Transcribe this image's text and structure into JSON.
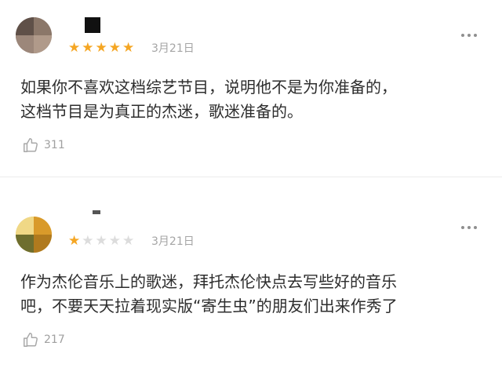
{
  "reviews": [
    {
      "rating": 5,
      "max_rating": 5,
      "date": "3月21日",
      "content_lines": [
        "如果你不喜欢这档综艺节目，说明他不是为你准备的，",
        "这档节目是为真正的杰迷，歌迷准备的。"
      ],
      "likes": "311"
    },
    {
      "rating": 1,
      "max_rating": 5,
      "date": "3月21日",
      "content_lines": [
        "作为杰伦音乐上的歌迷，拜托杰伦快点去写些好的音乐",
        "吧，不要天天拉着现实版“寄生虫”的朋友们出来作秀了"
      ],
      "likes": "217"
    }
  ],
  "colors": {
    "star_on": "#f5a623",
    "star_off": "#dcdcdc",
    "meta_text": "#a5a5a5",
    "body_text": "#2d2d2d",
    "divider": "#ececec"
  },
  "icons": {
    "like": "thumbs-up-icon",
    "more": "more-dots-icon"
  }
}
